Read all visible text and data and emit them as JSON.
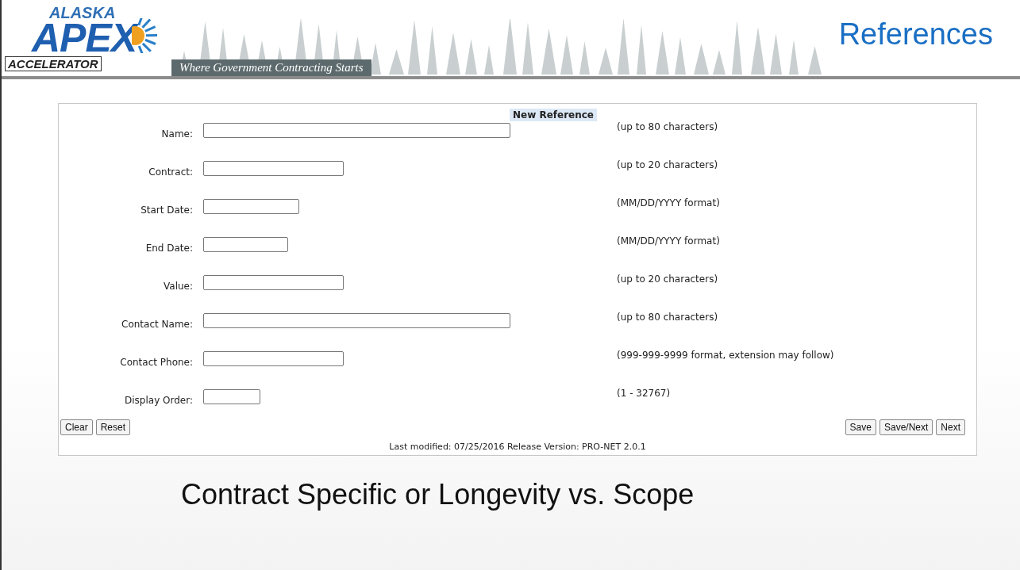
{
  "header": {
    "logo_top": "ALASKA",
    "logo_main": "APEX",
    "logo_bottom": "ACCELERATOR",
    "tagline": "Where Government Contracting Starts",
    "title": "References"
  },
  "form": {
    "title": "New Reference",
    "fields": [
      {
        "label": "Name:",
        "hint": "(up to 80 characters)"
      },
      {
        "label": "Contract:",
        "hint": "(up to 20 characters)"
      },
      {
        "label": "Start Date:",
        "hint": "(MM/DD/YYYY format)"
      },
      {
        "label": "End Date:",
        "hint": "(MM/DD/YYYY format)"
      },
      {
        "label": "Value:",
        "hint": "(up to 20 characters)"
      },
      {
        "label": "Contact Name:",
        "hint": "(up to 80 characters)"
      },
      {
        "label": "Contact Phone:",
        "hint": "(999-999-9999 format, extension may follow)"
      },
      {
        "label": "Display Order:",
        "hint": "(1 - 32767)"
      }
    ],
    "left_buttons": [
      "Clear",
      "Reset"
    ],
    "right_buttons": [
      "Save",
      "Save/Next",
      "Next"
    ],
    "footer": "Last modified: 07/25/2016 Release Version: PRO-NET 2.0.1"
  },
  "caption": "Contract Specific or Longevity vs. Scope"
}
